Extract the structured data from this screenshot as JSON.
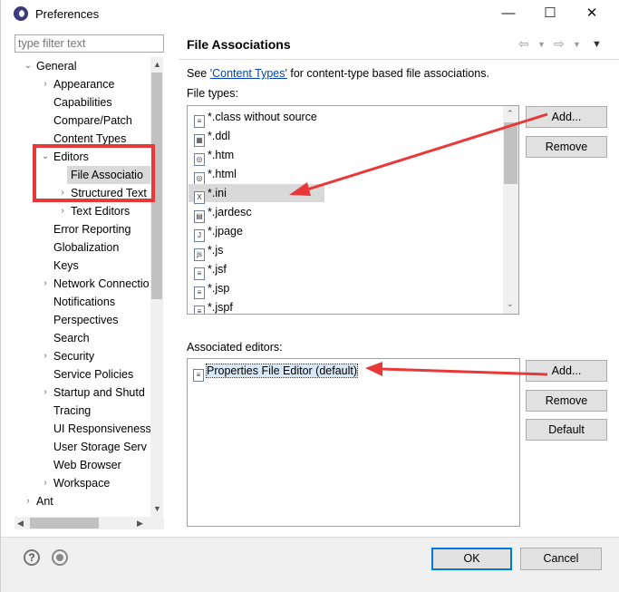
{
  "window": {
    "title": "Preferences"
  },
  "filter": {
    "placeholder": "type filter text"
  },
  "tree": {
    "general": "General",
    "appearance": "Appearance",
    "capabilities": "Capabilities",
    "compare_patch": "Compare/Patch",
    "content_types": "Content Types",
    "editors": "Editors",
    "file_associations": "File Associatio",
    "structured_text": "Structured Text",
    "text_editors": "Text Editors",
    "error_reporting": "Error Reporting",
    "globalization": "Globalization",
    "keys": "Keys",
    "network_connections": "Network Connectio",
    "notifications": "Notifications",
    "perspectives": "Perspectives",
    "search": "Search",
    "security": "Security",
    "service_policies": "Service Policies",
    "startup_shutdown": "Startup and Shutd",
    "tracing": "Tracing",
    "ui_responsiveness": "UI Responsiveness",
    "user_storage": "User Storage Serv",
    "web_browser": "Web Browser",
    "workspace": "Workspace",
    "ant": "Ant"
  },
  "page": {
    "title": "File Associations",
    "see_prefix": "See ",
    "see_link": "'Content Types'",
    "see_suffix": " for content-type based file associations.",
    "file_types_label": "File types:",
    "associated_editors_label": "Associated editors:"
  },
  "file_types": [
    {
      "name": "*.class without source",
      "icon": "file-text-icon"
    },
    {
      "name": "*.ddl",
      "icon": "ddl-file-icon"
    },
    {
      "name": "*.htm",
      "icon": "html-file-icon"
    },
    {
      "name": "*.html",
      "icon": "html-file-icon"
    },
    {
      "name": "*.ini",
      "icon": "ini-file-icon"
    },
    {
      "name": "*.jardesc",
      "icon": "jardesc-file-icon"
    },
    {
      "name": "*.jpage",
      "icon": "java-file-icon"
    },
    {
      "name": "*.js",
      "icon": "js-file-icon"
    },
    {
      "name": "*.jsf",
      "icon": "file-text-icon"
    },
    {
      "name": "*.jsp",
      "icon": "file-text-icon"
    },
    {
      "name": "*.jspf",
      "icon": "file-text-icon"
    }
  ],
  "associated_editors": [
    {
      "name": "Properties File Editor (default)",
      "icon": "file-text-icon"
    }
  ],
  "buttons": {
    "add_file_type": "Add...",
    "remove_file_type": "Remove",
    "add_editor": "Add...",
    "remove_editor": "Remove",
    "default": "Default",
    "ok": "OK",
    "cancel": "Cancel"
  },
  "footer": {
    "help_glyph": "?"
  },
  "colors": {
    "annotation_red": "#e83838",
    "selection": "#d9d9d9",
    "link": "#0645ad"
  }
}
